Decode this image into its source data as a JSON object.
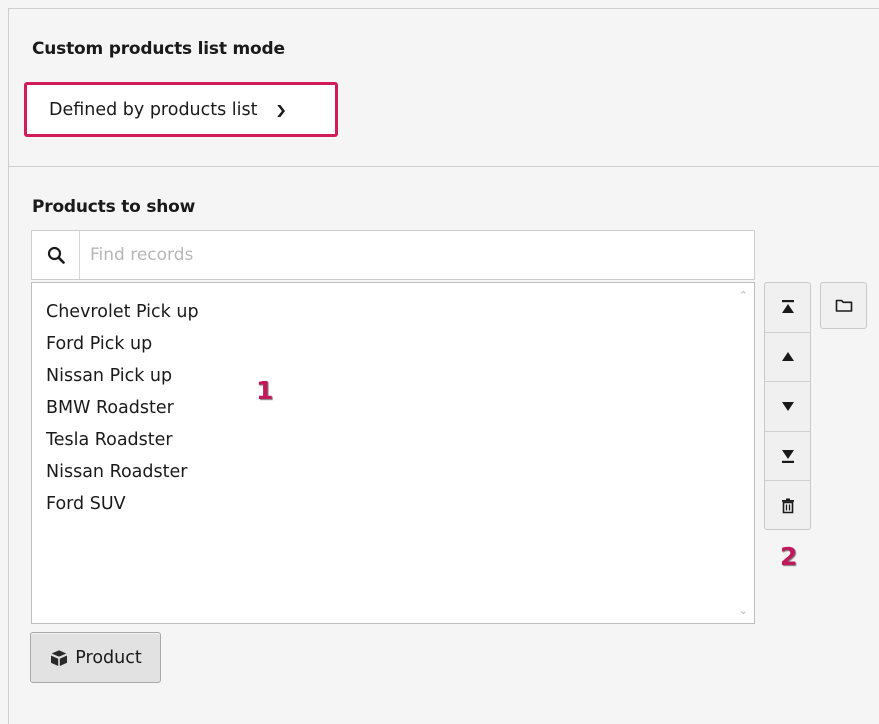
{
  "mode": {
    "label": "Custom products list mode",
    "selected": "Defined by products list",
    "highlight_color": "#d21c5a"
  },
  "products": {
    "label": "Products to show",
    "search_placeholder": "Find records",
    "items": [
      "Chevrolet Pick up",
      "Ford Pick up",
      "Nissan Pick up",
      "BMW Roadster",
      "Tesla Roadster",
      "Nissan Roadster",
      "Ford SUV"
    ],
    "add_button": "Product"
  },
  "markers": {
    "list": "1",
    "buttons": "2",
    "color": "#c2185b"
  },
  "icons": {
    "search": "search-icon",
    "move_top": "move-to-top-icon",
    "move_up": "move-up-icon",
    "move_down": "move-down-icon",
    "move_bottom": "move-to-bottom-icon",
    "delete": "trash-icon",
    "browse": "folder-icon",
    "product": "product-icon"
  }
}
